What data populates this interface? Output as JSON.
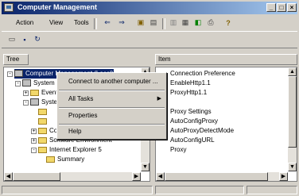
{
  "window": {
    "title": "Computer Management",
    "buttons": {
      "minimize": "_",
      "maximize": "□",
      "close": "×"
    }
  },
  "menubar": {
    "items": [
      "Action",
      "View",
      "Tools"
    ]
  },
  "toolbar1": {
    "icons": [
      "back-arrow-icon",
      "forward-arrow-icon",
      "up-folder-icon",
      "show-tree-icon",
      "delete-icon",
      "properties-icon",
      "refresh-icon",
      "export-icon",
      "help-icon"
    ],
    "glyphs": [
      "⇐",
      "⇒",
      "▣",
      "▤",
      "▥",
      "▦",
      "◧",
      "⎙",
      "?"
    ]
  },
  "toolbar2": {
    "icons": [
      "console-icon",
      "save-icon",
      "new-window-icon"
    ],
    "glyphs": [
      "▭",
      "▪",
      "↻"
    ]
  },
  "left_pane": {
    "header": "Tree",
    "tree": [
      {
        "label": "Computer Management (Local)",
        "indent": 0,
        "icon": "pc",
        "expander": "-"
      },
      {
        "label": "System Tools",
        "indent": 1,
        "icon": "pc",
        "expander": "-"
      },
      {
        "label": "Event Viewer",
        "indent": 2,
        "icon": "folder",
        "expander": "+"
      },
      {
        "label": "System Information",
        "indent": 2,
        "icon": "pc",
        "expander": "-"
      },
      {
        "label": "",
        "indent": 3,
        "icon": "folder",
        "expander": ""
      },
      {
        "label": "",
        "indent": 3,
        "icon": "folder",
        "expander": ""
      },
      {
        "label": "Components",
        "indent": 3,
        "icon": "folder",
        "expander": "+"
      },
      {
        "label": "Software Environment",
        "indent": 3,
        "icon": "folder",
        "expander": "+"
      },
      {
        "label": "Internet Explorer 5",
        "indent": 3,
        "icon": "folder",
        "expander": "-"
      },
      {
        "label": "Summary",
        "indent": 4,
        "icon": "folder",
        "expander": ""
      }
    ]
  },
  "right_pane": {
    "header": "Item",
    "items": [
      "Connection Preference",
      "EnableHttp1.1",
      "ProxyHttp1.1",
      "",
      "Proxy Settings",
      "AutoConfigProxy",
      "AutoProxyDetectMode",
      "AutoConfigURL",
      "Proxy"
    ]
  },
  "context_menu": {
    "items": [
      {
        "label": "Connect to another computer ...",
        "submenu": false
      },
      {
        "label": "All Tasks",
        "submenu": true
      },
      {
        "label": "Properties",
        "submenu": false
      },
      {
        "label": "Help",
        "submenu": false
      }
    ]
  }
}
